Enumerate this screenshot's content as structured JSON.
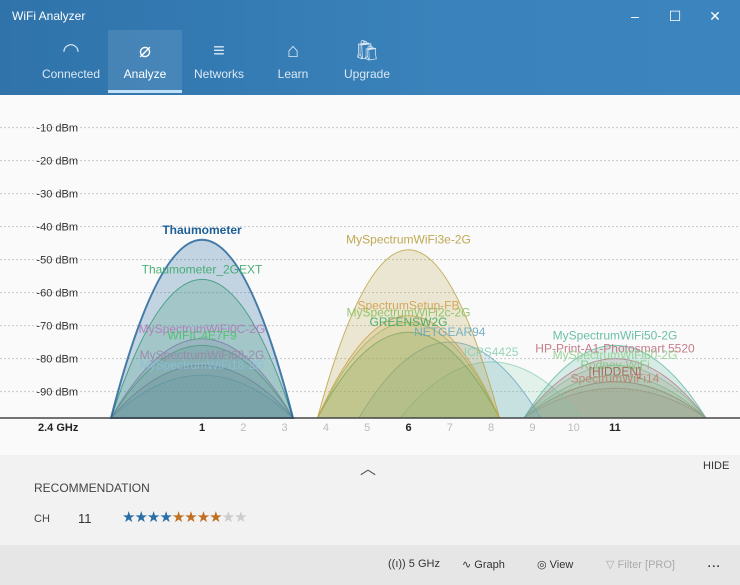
{
  "window": {
    "title": "WiFi Analyzer"
  },
  "tabs": [
    {
      "label": "Connected",
      "icon": "wifi-icon"
    },
    {
      "label": "Analyze",
      "icon": "magnifier-icon"
    },
    {
      "label": "Networks",
      "icon": "list-icon"
    },
    {
      "label": "Learn",
      "icon": "graduation-cap-icon"
    },
    {
      "label": "Upgrade",
      "icon": "shopping-bag-icon"
    }
  ],
  "chart_data": {
    "type": "area",
    "band_label": "2.4 GHz",
    "y_ticks": [
      "-10 dBm",
      "-20 dBm",
      "-30 dBm",
      "-40 dBm",
      "-50 dBm",
      "-60 dBm",
      "-70 dBm",
      "-80 dBm",
      "-90 dBm"
    ],
    "ylim": [
      -98,
      0
    ],
    "channels": [
      1,
      2,
      3,
      4,
      5,
      6,
      7,
      8,
      9,
      10,
      11
    ],
    "highlighted_channels": [
      1,
      6,
      11
    ],
    "networks": [
      {
        "name": "Thaumometer",
        "channel": 1,
        "dbm": -44,
        "color": "#1d5f96",
        "bold": true
      },
      {
        "name": "Thaumometer_2GEXT",
        "channel": 1,
        "dbm": -56,
        "color": "#3aa86a"
      },
      {
        "name": "MySpectrumWiFi0C-2G",
        "channel": 1,
        "dbm": -74,
        "color": "#b07ab8"
      },
      {
        "name": "WIFIC4E7F9",
        "channel": 1,
        "dbm": -76,
        "color": "#4cc06a"
      },
      {
        "name": "MySpectrumWiFi68-2G",
        "channel": 1,
        "dbm": -82,
        "color": "#9a86a8"
      },
      {
        "name": "MySpectrumWiFi18-2G",
        "channel": 1,
        "dbm": -85,
        "color": "#8cc0d8"
      },
      {
        "name": "MySpectrumWiFi3e-2G",
        "channel": 6,
        "dbm": -47,
        "color": "#b8a040"
      },
      {
        "name": "SpectrumSetup-FB",
        "channel": 6,
        "dbm": -67,
        "color": "#d0a050"
      },
      {
        "name": "MySpectrumWiFi2c-2G",
        "channel": 6,
        "dbm": -69,
        "color": "#8cc060"
      },
      {
        "name": "GREENSW2G",
        "channel": 6,
        "dbm": -72,
        "color": "#3aa860"
      },
      {
        "name": "NETGEAR94",
        "channel": 7,
        "dbm": -75,
        "color": "#6aa8c0"
      },
      {
        "name": "ICPS4425",
        "channel": 8,
        "dbm": -81,
        "color": "#8cd0b0"
      },
      {
        "name": "MySpectrumWiFi50-2G",
        "channel": 11,
        "dbm": -76,
        "color": "#5cb8a0"
      },
      {
        "name": "HP-Print-A1-Photosmart 5520",
        "channel": 11,
        "dbm": -80,
        "color": "#c07080"
      },
      {
        "name": "MySpectrumWiFi60-2G",
        "channel": 11,
        "dbm": -82,
        "color": "#90d090"
      },
      {
        "name": "Rodney-WiFi",
        "channel": 11,
        "dbm": -85,
        "color": "#80c880"
      },
      {
        "name": "[HIDDEN]",
        "channel": 11,
        "dbm": -87,
        "color": "#a06050"
      },
      {
        "name": "SpectrumWiFi14",
        "channel": 11,
        "dbm": -89,
        "color": "#c08070"
      }
    ]
  },
  "panel": {
    "hide": "HIDE",
    "recommendation_title": "RECOMMENDATION",
    "ch_label": "CH",
    "channel": "11",
    "rating": 8,
    "rating_max": 10
  },
  "cmdbar": {
    "band": "5 GHz",
    "graph": "Graph",
    "view": "View",
    "filter": "Filter [PRO]",
    "more": "..."
  }
}
